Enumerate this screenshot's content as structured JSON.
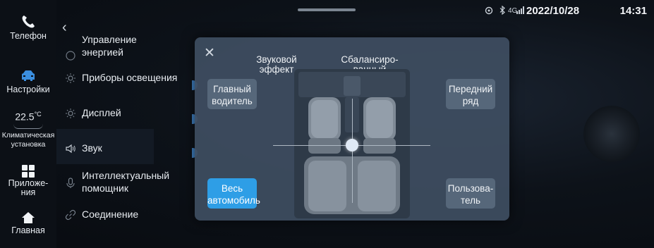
{
  "status_bar": {
    "icons": [
      "car-link-icon",
      "bluetooth-icon",
      "4g-signal-icon"
    ],
    "network": "4G",
    "date": "2022/10/28",
    "time": "14:31"
  },
  "dock": {
    "phone": "Телефон",
    "settings": "Настройки",
    "climate_value": "22.5",
    "climate_unit": "°C",
    "climate_label_1": "Климатическая",
    "climate_label_2": "установка",
    "apps_line_1": "Приложе-",
    "apps_line_2": "ния",
    "home": "Главная"
  },
  "menu": {
    "items": [
      {
        "line1": "Управление",
        "line2": "энергией"
      },
      {
        "line1": "Приборы освещения"
      },
      {
        "line1": "Дисплей"
      },
      {
        "line1": "Звук"
      },
      {
        "line1": "Интеллектуальный",
        "line2": "помощник"
      },
      {
        "line1": "Соединение"
      }
    ],
    "active_index": 3
  },
  "dialog": {
    "sound_effect_1": "Звуковой",
    "sound_effect_2": "эффект",
    "balanced_1": "Сбалансиро-",
    "balanced_2": "ванный",
    "main_driver_1": "Главный",
    "main_driver_2": "водитель",
    "front_row_1": "Передний",
    "front_row_2": "ряд",
    "whole_car_1": "Весь",
    "whole_car_2": "автомобиль",
    "user_1": "Пользова-",
    "user_2": "тель",
    "selected": "Весь автомобиль"
  },
  "colors": {
    "accent": "#2e9ee6",
    "dialog_bg": "#3e4e61",
    "button_bg": "#56677a",
    "dock_active_icon": "#3b8fe0"
  }
}
